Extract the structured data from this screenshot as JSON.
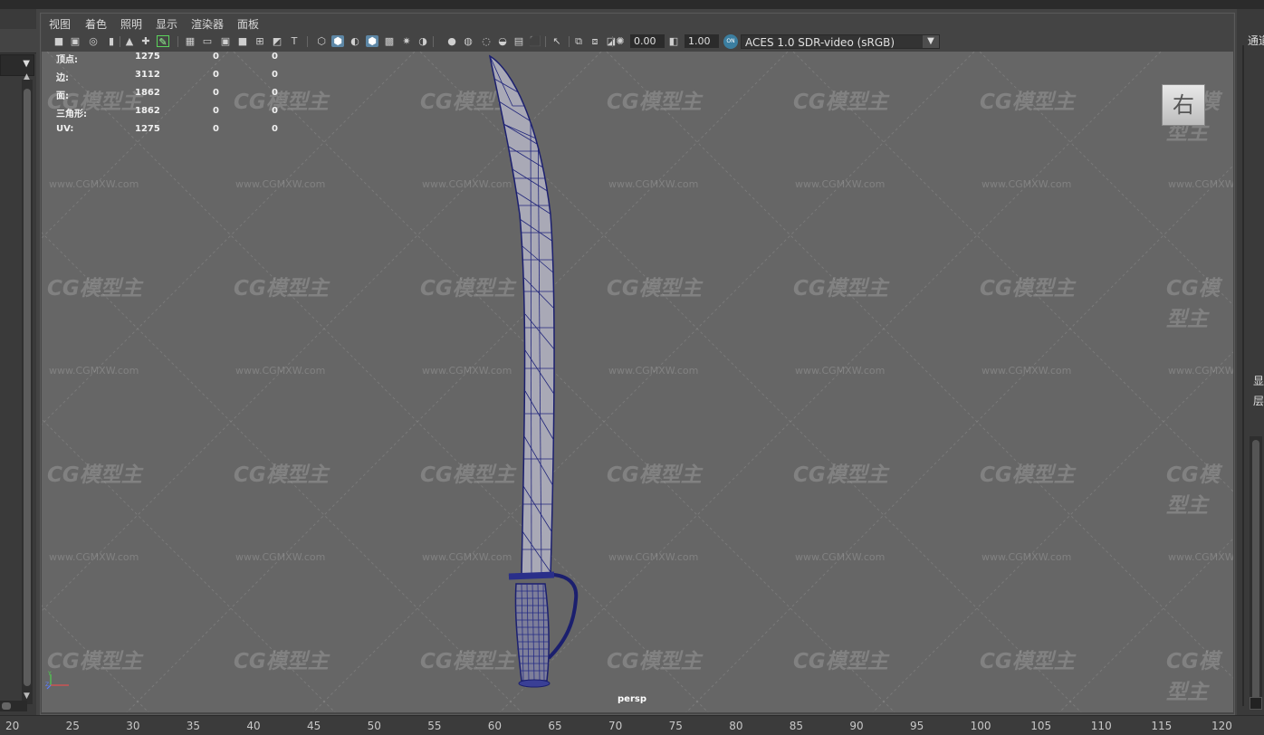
{
  "menu": [
    "视图",
    "着色",
    "照明",
    "显示",
    "渲染器",
    "面板"
  ],
  "toolbar": {
    "exposure_value": "0.00",
    "gamma_value": "1.00",
    "ocio_badge": "ON",
    "color_space": "ACES 1.0 SDR-video (sRGB)",
    "icons": [
      "camera-icon",
      "camera-attributes-icon",
      "bookmark-icon",
      "image-plane-icon",
      "grease-pencil-icon",
      "2d-pan-zoom-icon",
      "grid-icon",
      "film-gate-icon",
      "resolution-gate-icon",
      "gate-mask-icon",
      "field-chart-icon",
      "safe-action-icon",
      "safe-title-icon",
      "wireframe-icon",
      "smooth-shade-icon",
      "default-material-icon",
      "wireframe-on-shaded-icon",
      "xray-icon",
      "textured-icon",
      "lights-icon",
      "shadows-icon",
      "screen-space-ao-icon",
      "motion-blur-icon",
      "anti-aliasing-icon",
      "depth-of-field-icon",
      "isolate-select-icon",
      "xray-joints-icon",
      "xray-active-icon",
      "backface-icon"
    ]
  },
  "hud": {
    "rows": [
      {
        "label": "顶点:",
        "values": [
          "1275",
          "0",
          "0"
        ]
      },
      {
        "label": "边:",
        "values": [
          "3112",
          "0",
          "0"
        ]
      },
      {
        "label": "面:",
        "values": [
          "1862",
          "0",
          "0"
        ]
      },
      {
        "label": "三角形:",
        "values": [
          "1862",
          "0",
          "0"
        ]
      },
      {
        "label": "UV:",
        "values": [
          "1275",
          "0",
          "0"
        ]
      }
    ]
  },
  "viewcube_label": "右",
  "camera_label": "persp",
  "watermark": {
    "logo": "CG模型主",
    "url": "www.CGMXW.com"
  },
  "right_panel": {
    "top_label": "通道",
    "mid_label_1": "显",
    "mid_label_2": "层"
  },
  "timeline": [
    "20",
    "25",
    "30",
    "35",
    "40",
    "45",
    "50",
    "55",
    "60",
    "65",
    "70",
    "75",
    "80",
    "85",
    "90",
    "95",
    "100",
    "105",
    "110",
    "115",
    "120"
  ]
}
